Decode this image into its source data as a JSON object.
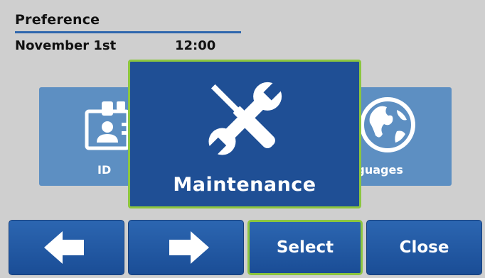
{
  "header": {
    "title": "Preference",
    "date": "November 1st",
    "time": "12:00"
  },
  "carousel": {
    "left_card": {
      "label": "ID",
      "icon": "id-card-icon"
    },
    "center_card": {
      "label": "Maintenance",
      "icon": "wrench-screwdriver-icon"
    },
    "right_card": {
      "label": "nguages",
      "icon": "globe-icon"
    }
  },
  "buttons": {
    "prev_icon": "arrow-left-icon",
    "next_icon": "arrow-right-icon",
    "select_label": "Select",
    "close_label": "Close"
  },
  "colors": {
    "background": "#cfcfcf",
    "accent_blue": "#1f4f95",
    "side_card": "#5d8fc2",
    "highlight_green": "#8cc63f"
  }
}
